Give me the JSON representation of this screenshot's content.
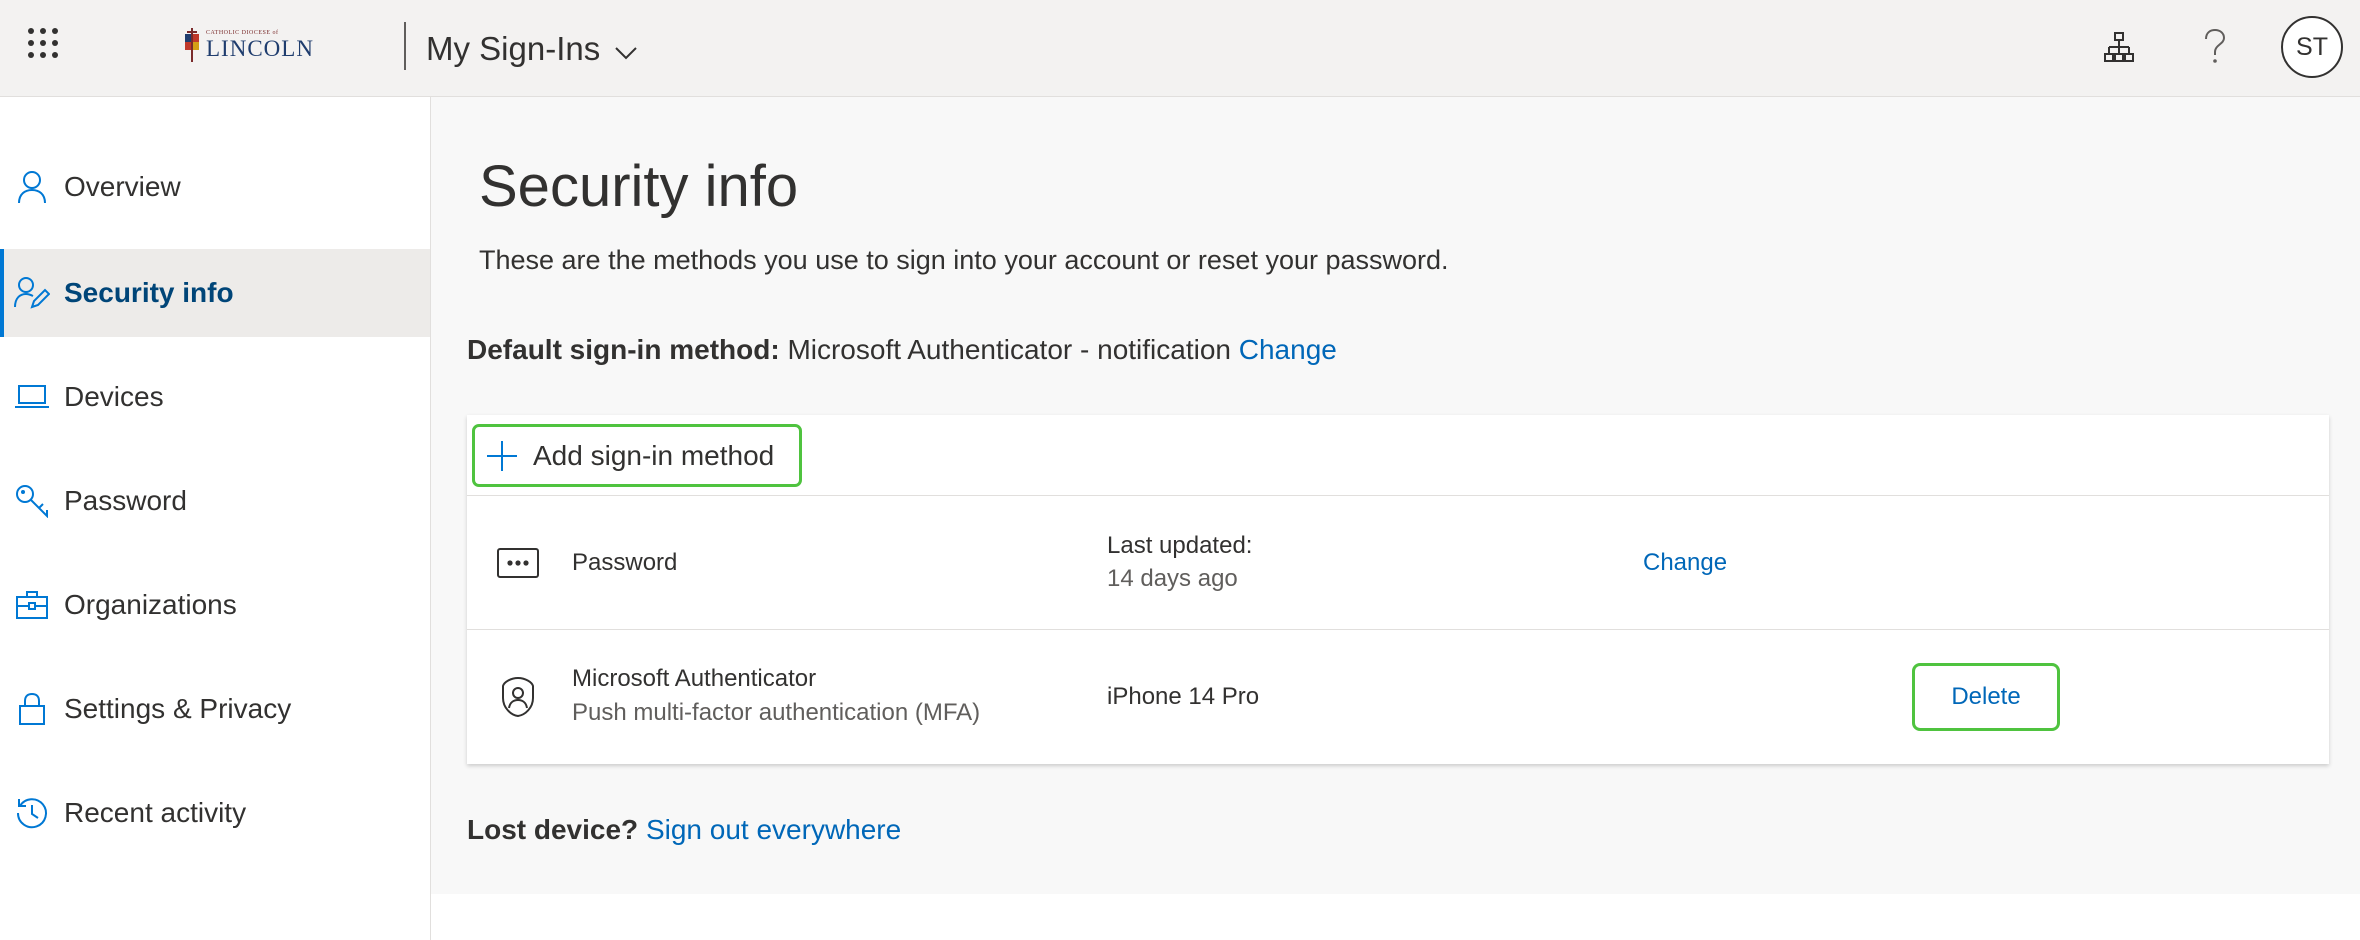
{
  "header": {
    "logo_small": "CATHOLIC DIOCESE of",
    "logo_main": "LINCOLN",
    "app_title": "My Sign-Ins",
    "avatar_initials": "ST",
    "icons": [
      "waffle-icon",
      "org-chart-icon",
      "help-icon"
    ]
  },
  "sidebar": {
    "items": [
      {
        "label": "Overview",
        "icon": "person-icon"
      },
      {
        "label": "Security info",
        "icon": "person-edit-icon",
        "active": true
      },
      {
        "label": "Devices",
        "icon": "laptop-icon"
      },
      {
        "label": "Password",
        "icon": "key-icon"
      },
      {
        "label": "Organizations",
        "icon": "briefcase-icon"
      },
      {
        "label": "Settings & Privacy",
        "icon": "lock-icon"
      },
      {
        "label": "Recent activity",
        "icon": "history-icon"
      }
    ]
  },
  "main": {
    "title": "Security info",
    "description": "These are the methods you use to sign into your account or reset your password.",
    "default_method_label": "Default sign-in method:",
    "default_method_value": "Microsoft Authenticator - notification",
    "default_method_change": "Change",
    "add_method_label": "Add sign-in method",
    "methods": [
      {
        "icon": "password-dots-icon",
        "name": "Password",
        "detail_label": "Last updated:",
        "detail_value": "14 days ago",
        "action": "Change"
      },
      {
        "icon": "authenticator-icon",
        "name": "Microsoft Authenticator",
        "subtitle": "Push multi-factor authentication (MFA)",
        "detail_value": "iPhone 14 Pro",
        "action": "Delete"
      }
    ],
    "lost_device_label": "Lost device?",
    "lost_device_link": "Sign out everywhere"
  },
  "colors": {
    "accent": "#0078d4",
    "link": "#0067b8",
    "highlight_border": "#4fc33f",
    "active_nav_bg": "#edebe9"
  }
}
